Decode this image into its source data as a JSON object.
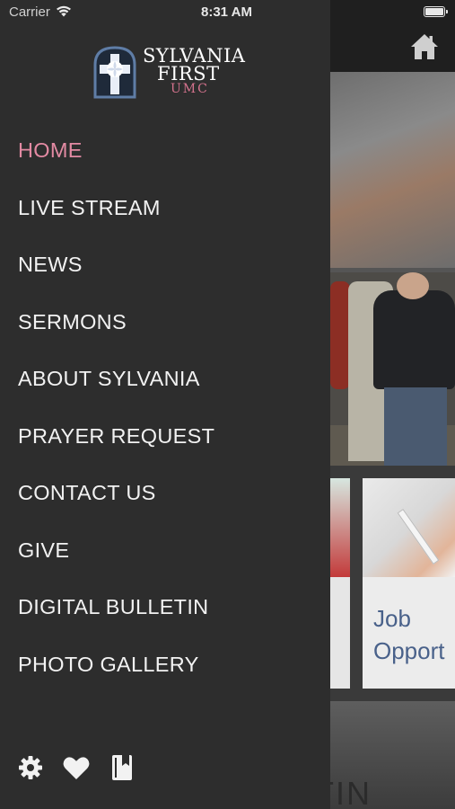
{
  "status_bar": {
    "carrier": "Carrier",
    "time": "8:31 AM"
  },
  "logo": {
    "line1": "SYLVANIA",
    "line2": "FIRST",
    "line3": "UMC",
    "accent_color": "#d5738e",
    "mark_frame_color": "#5f7da6"
  },
  "menu": {
    "active_color": "#e38aa3",
    "items": [
      {
        "label": "HOME",
        "active": true
      },
      {
        "label": "LIVE STREAM"
      },
      {
        "label": "NEWS"
      },
      {
        "label": "SERMONS"
      },
      {
        "label": "ABOUT SYLVANIA"
      },
      {
        "label": "PRAYER REQUEST"
      },
      {
        "label": "CONTACT US"
      },
      {
        "label": "GIVE"
      },
      {
        "label": "DIGITAL BULLETIN"
      },
      {
        "label": "PHOTO GALLERY"
      }
    ]
  },
  "drawer_icons": [
    "gear-icon",
    "heart-icon",
    "bookmark-book-icon"
  ],
  "background": {
    "header_icon": "home-icon",
    "card_title": "Job\nOpport",
    "bottom_text": "TIN"
  }
}
